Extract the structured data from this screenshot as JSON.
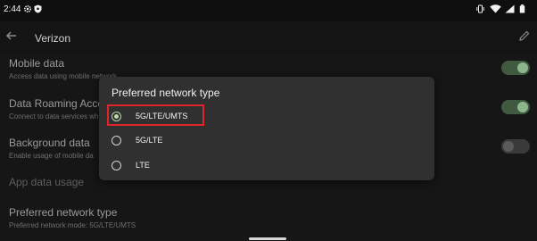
{
  "status_bar": {
    "time": "2:44",
    "icons": [
      "gear-icon",
      "shield-icon",
      "vibrate-icon",
      "wifi-icon",
      "signal-icon",
      "battery-icon"
    ]
  },
  "app_bar": {
    "title": "Verizon",
    "back_icon": "arrow-back-icon",
    "edit_icon": "pencil-icon"
  },
  "settings": {
    "mobile_data": {
      "title": "Mobile data",
      "subtitle": "Access data using mobile network",
      "toggle": "on"
    },
    "data_roaming": {
      "title": "Data Roaming Acces",
      "subtitle": "Connect to data services wh",
      "toggle": "on"
    },
    "background_data": {
      "title": "Background data",
      "subtitle": "Enable usage of mobile da",
      "toggle": "off"
    },
    "app_data_usage": {
      "title": "App data usage"
    },
    "preferred_network": {
      "title": "Preferred network type",
      "subtitle": "Preferred network mode: 5G/LTE/UMTS"
    }
  },
  "dialog": {
    "title": "Preferred network type",
    "options": [
      {
        "label": "5G/LTE/UMTS",
        "selected": true
      },
      {
        "label": "5G/LTE",
        "selected": false
      },
      {
        "label": "LTE",
        "selected": false
      }
    ]
  },
  "colors": {
    "accent": "#b9dca8",
    "highlight_box": "#e0242c",
    "dialog_bg": "#303030"
  }
}
